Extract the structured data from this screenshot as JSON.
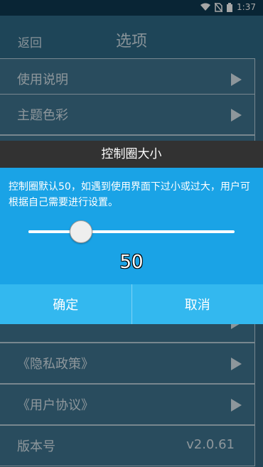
{
  "status_bar": {
    "time": "1:37"
  },
  "header": {
    "back_label": "返回",
    "title": "选项"
  },
  "list": {
    "items": [
      {
        "label": "使用说明"
      },
      {
        "label": "主题色彩"
      },
      {
        "label": ""
      },
      {
        "label": ""
      },
      {
        "label": ""
      },
      {
        "label": ""
      },
      {
        "label": "《隐私政策》"
      },
      {
        "label": "《用户协议》"
      }
    ],
    "version_label": "版本号",
    "version_value": "v2.0.61"
  },
  "dialog": {
    "title": "控制圈大小",
    "message": "控制圈默认50，如遇到使用界面下过小或过大，用户可根据自己需要进行设置。",
    "slider": {
      "value": 50,
      "min": 0,
      "max": 200
    },
    "value_text": "50",
    "confirm_label": "确定",
    "cancel_label": "取消"
  }
}
